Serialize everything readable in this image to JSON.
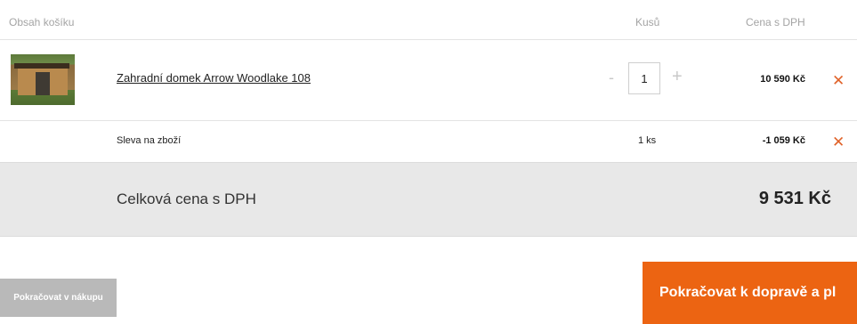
{
  "header": {
    "content_label": "Obsah košíku",
    "qty_label": "Kusů",
    "price_label": "Cena s DPH"
  },
  "product": {
    "name": "Zahradní domek Arrow Woodlake 108",
    "quantity": "1",
    "minus_symbol": "-",
    "plus_symbol": "+",
    "price": "10 590 Kč",
    "remove_symbol": "✕"
  },
  "discount": {
    "label": "Sleva na zboží",
    "quantity": "1 ks",
    "price": "-1 059 Kč",
    "remove_symbol": "✕"
  },
  "total": {
    "label": "Celková cena s DPH",
    "value": "9 531 Kč"
  },
  "buttons": {
    "back_label": "Pokračovat v nákupu",
    "next_label": "Pokračovat k dopravě a pl"
  },
  "colors": {
    "accent": "#ec6412",
    "remove": "#e0632a",
    "total_bg": "#e8e8e8",
    "back_button": "#b9b9b9"
  }
}
